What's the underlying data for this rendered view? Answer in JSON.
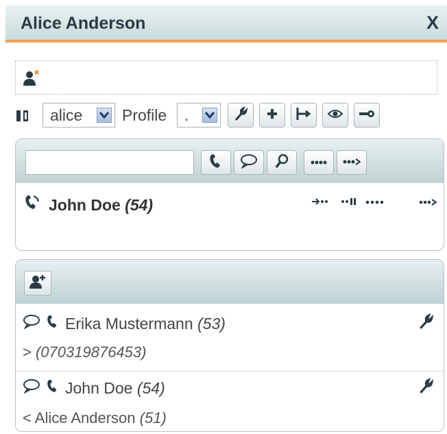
{
  "window": {
    "title": "Alice Anderson",
    "close_label": "X"
  },
  "toolbar": {
    "user_select": "alice",
    "profile_label": "Profile",
    "profile_select": "."
  },
  "active_call": {
    "name": "John Doe",
    "number": "(54)",
    "actions": [
      "transfer",
      "hold",
      "more",
      "forward"
    ]
  },
  "contacts": [
    {
      "name": "Erika Mustermann",
      "number": "(53)",
      "direction": ">",
      "detail": "(070319876453)"
    },
    {
      "name": "John Doe",
      "number": "(54)",
      "direction": "<",
      "detail_name": "Alice Anderson",
      "detail_number": "(51)"
    }
  ],
  "colors": {
    "accent": "#f0a050",
    "header": "#c9dadb",
    "text": "#2a3b45"
  }
}
